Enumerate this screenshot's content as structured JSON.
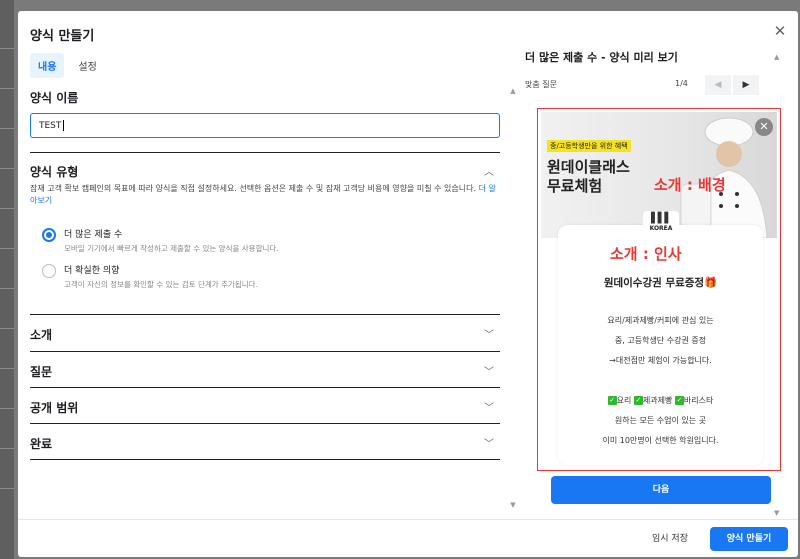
{
  "modal": {
    "title": "양식 만들기",
    "close_icon": "close-icon"
  },
  "tabs": [
    {
      "label": "내용",
      "active": true
    },
    {
      "label": "설정",
      "active": false
    }
  ],
  "form": {
    "name_section": {
      "title": "양식 이름",
      "input_value": "TEST"
    },
    "type_section": {
      "title": "양식 유형",
      "description": "잠재 고객 확보 캠페인의 목표에 따라 양식을 직접 설정하세요. 선택한 옵션은 제출 수 및 잠재 고객당 비용에 영향을 미칠 수 있습니다.",
      "learn_more": "더 알아보기",
      "options": [
        {
          "label": "더 많은 제출 수",
          "sub": "모바일 기기에서 빠르게 작성하고 제출할 수 있는 양식을 사용합니다.",
          "selected": true
        },
        {
          "label": "더 확실한 의향",
          "sub": "고객이 자신의 정보를 확인할 수 있는 검토 단계가 추가됩니다.",
          "selected": false
        }
      ]
    },
    "collapsed_sections": [
      {
        "title": "소개"
      },
      {
        "title": "질문"
      },
      {
        "title": "공개 범위"
      },
      {
        "title": "완료"
      }
    ]
  },
  "preview": {
    "title": "더 많은 제출 수 - 양식 미리 보기",
    "question_label": "맞춤 질문",
    "page_counter": "1/4",
    "image": {
      "badge": "중/고등학생만을 위한 혜택",
      "headline_line1": "원데이클래스",
      "headline_line2": "무료체험",
      "annotation": "소개 : 배경"
    },
    "card": {
      "logo_text": "KOREA",
      "annotation": "소개 : 인사",
      "heading": "원데이수강권 무료증정",
      "gift_icon": "🎁",
      "lines": [
        "요리/제과제빵/커피에 관심 있는",
        "중, 고등학생단 수강권 증정",
        "→대전점만 체험이 가능합니다."
      ],
      "checks": [
        "요리",
        "제과제빵",
        "바리스타"
      ],
      "footer_lines": [
        "원하는 모든 수업이 있는 곳",
        "이미 10만명이 선택한 학원입니다."
      ]
    },
    "next_button": "다음"
  },
  "footer": {
    "save_draft": "임시 저장",
    "create": "양식 만들기"
  }
}
